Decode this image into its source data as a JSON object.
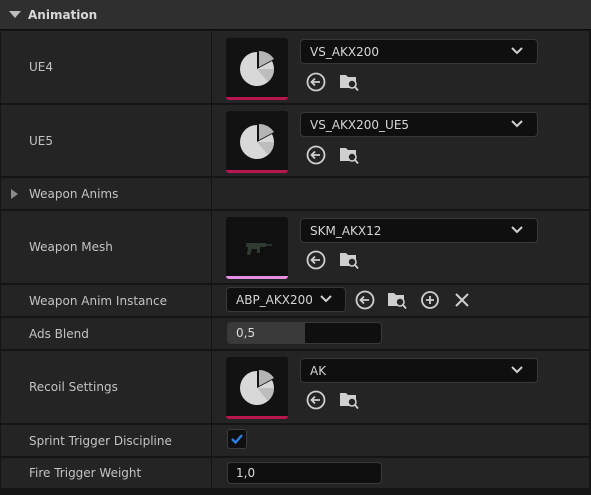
{
  "header": {
    "title": "Animation"
  },
  "rows": {
    "ue4": {
      "label": "UE4",
      "asset": "VS_AKX200"
    },
    "ue5": {
      "label": "UE5",
      "asset": "VS_AKX200_UE5"
    },
    "weapon_anims": {
      "label": "Weapon Anims"
    },
    "weapon_mesh": {
      "label": "Weapon Mesh",
      "asset": "SKM_AKX12"
    },
    "weapon_anim_instance": {
      "label": "Weapon Anim Instance",
      "asset": "ABP_AKX200"
    },
    "ads_blend": {
      "label": "Ads Blend",
      "value": "0,5",
      "fraction": 0.5
    },
    "recoil_settings": {
      "label": "Recoil Settings",
      "asset": "AK"
    },
    "sprint_trigger_discipline": {
      "label": "Sprint Trigger Discipline",
      "checked": true
    },
    "fire_trigger_weight": {
      "label": "Fire Trigger Weight",
      "value": "1,0"
    }
  },
  "icons": {
    "use_selected": "arrow-left-circle-icon",
    "browse": "folder-search-icon",
    "add": "plus-circle-icon",
    "clear": "x-icon",
    "asset_type": "pie-chart-icon",
    "mesh": "skeletal-mesh-preview-icon"
  },
  "colors": {
    "data_asset_bar": "#b8164f",
    "mesh_bar": "#e58ee5",
    "checkbox_accent": "#2a7fe0"
  }
}
